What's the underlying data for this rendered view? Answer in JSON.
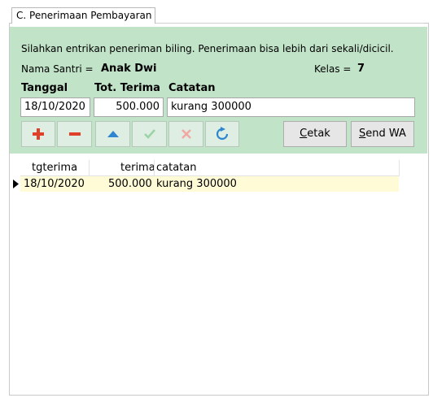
{
  "tab": {
    "label": "C. Penerimaan Pembayaran"
  },
  "info": {
    "instruction": "Silahkan entrikan peneriman biling. Penerimaan bisa lebih dari sekali/dicicil.",
    "santri_label": "Nama Santri =",
    "santri_value": "Anak Dwi",
    "kelas_label": "Kelas =",
    "kelas_value": "7"
  },
  "form": {
    "tanggal_label": "Tanggal",
    "tanggal_value": "18/10/2020",
    "total_label": "Tot. Terima",
    "total_value": "500.000",
    "catatan_label": "Catatan",
    "catatan_value": "kurang 300000"
  },
  "toolbar": {
    "cetak_prefix": "C",
    "cetak_rest": "etak",
    "sendwa_prefix": "S",
    "sendwa_rest": "end WA",
    "icons": [
      "plus-icon",
      "minus-icon",
      "move-up-icon",
      "check-icon",
      "cancel-icon",
      "refresh-icon"
    ]
  },
  "grid": {
    "columns": [
      "tgterima",
      "terima",
      "catatan"
    ],
    "rows": [
      {
        "tgterima": "18/10/2020",
        "terima": "500.000",
        "catatan": "kurang 300000"
      }
    ]
  },
  "colors": {
    "panel_bg": "#c1e3c8",
    "row_highlight": "#fffbd6",
    "icon_red": "#e0402a",
    "icon_blue": "#2f86d0",
    "icon_disabled": "#9ad4a5",
    "icon_disabled_red": "#f0a9a2"
  }
}
